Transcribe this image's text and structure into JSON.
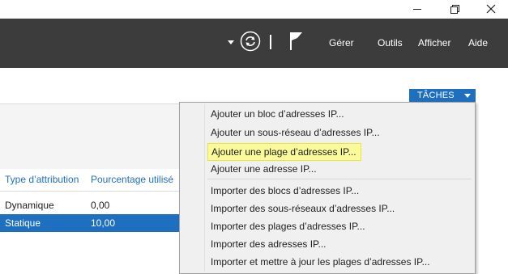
{
  "window": {
    "minimize_glyph": "—",
    "restore_glyph": "❐",
    "close_glyph": "✕"
  },
  "toolbar": {
    "menus": [
      "Gérer",
      "Outils",
      "Afficher",
      "Aide"
    ],
    "icons": [
      "dropdown-arrow-icon",
      "refresh-icon",
      "flag-icon"
    ]
  },
  "tasks_button": {
    "label": "TÂCHES"
  },
  "table": {
    "columns": [
      "Type d’attribution",
      "Pourcentage utilisé"
    ],
    "rows": [
      {
        "type": "Dynamique",
        "percent": "0,00",
        "selected": false
      },
      {
        "type": "Statique",
        "percent": "10,00",
        "selected": true
      }
    ]
  },
  "context_menu": {
    "items": [
      "Ajouter un bloc d’adresses IP...",
      "Ajouter un sous-réseau d’adresses IP...",
      "Ajouter une plage d’adresses IP...",
      "Ajouter une adresse IP...",
      "Importer des blocs d’adresses IP...",
      "Importer des sous-réseaux d’adresses IP...",
      "Importer des plages d’adresses IP...",
      "Importer des adresses IP...",
      "Importer et mettre à jour les plages d’adresses IP..."
    ],
    "highlighted_index": 2
  },
  "colors": {
    "topbar": "#3c3c3c",
    "accent": "#1e6fbf",
    "highlight": "#fafa9b"
  }
}
